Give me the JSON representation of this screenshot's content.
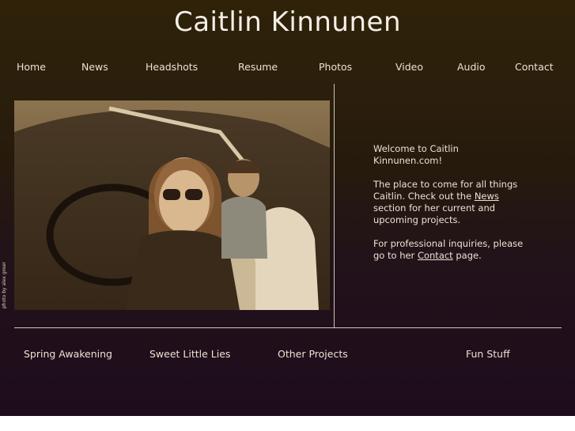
{
  "site": {
    "title": "Caitlin Kinnunen"
  },
  "nav": [
    "Home",
    "News",
    "Headshots",
    "Resume",
    "Photos",
    "Video",
    "Audio",
    "Contact"
  ],
  "photo": {
    "credit": "photo by alex greer"
  },
  "welcome": {
    "line1": "Welcome to Caitlin Kinnunen.com!",
    "p2_before": "The place to come for all things Caitlin.  Check out the ",
    "p2_link": "News",
    "p2_after": " section for her current and upcoming projects.",
    "p3_before": "For professional inquiries, please go to her ",
    "p3_link": "Contact",
    "p3_after": " page."
  },
  "bottom_links": [
    "Spring Awakening",
    "Sweet Little Lies",
    "Other Projects",
    "Fun Stuff"
  ]
}
